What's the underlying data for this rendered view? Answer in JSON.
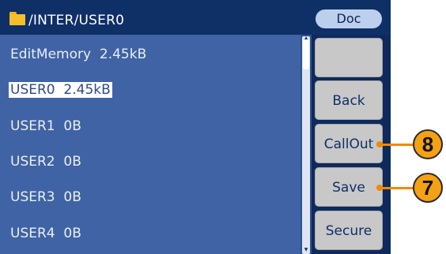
{
  "header": {
    "path": "/INTER/USER0",
    "doc_label": "Doc"
  },
  "file_list": [
    {
      "name": "EditMemory",
      "size": "2.45kB",
      "selected": false
    },
    {
      "name": "USER0",
      "size": "2.45kB",
      "selected": true
    },
    {
      "name": "USER1",
      "size": "0B",
      "selected": false
    },
    {
      "name": "USER2",
      "size": "0B",
      "selected": false
    },
    {
      "name": "USER3",
      "size": "0B",
      "selected": false
    },
    {
      "name": "USER4",
      "size": "0B",
      "selected": false
    }
  ],
  "softkeys": [
    "",
    "Back",
    "CallOut",
    "Save",
    "Secure"
  ],
  "callouts": [
    "8",
    "7"
  ],
  "colors": {
    "title_bar": "#0f2f67",
    "list_background": "#3f63a4",
    "softkey": "#c8c8c8",
    "callout": "#f5a114",
    "folder_icon": "#f6bf2a"
  },
  "icons": {
    "folder": "folder-icon",
    "scroll_up": "scroll-up-arrow-icon",
    "scroll_down": "scroll-down-arrow-icon"
  }
}
